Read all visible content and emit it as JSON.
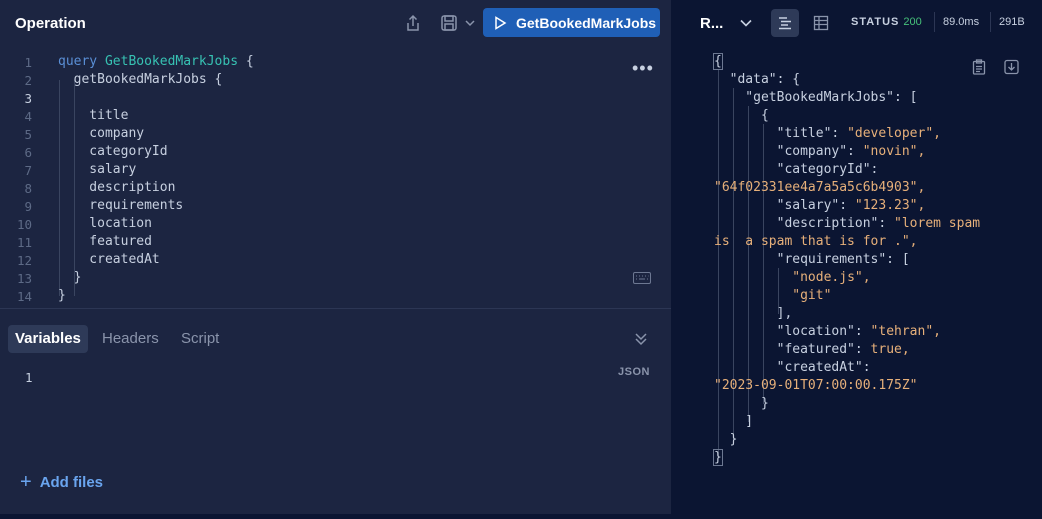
{
  "operation": {
    "title": "Operation",
    "run_label": "GetBookedMarkJobs",
    "code_lines": [
      {
        "num": "1",
        "text": ""
      },
      {
        "num": "2",
        "text": "  getBookedMarkJobs {"
      },
      {
        "num": "3",
        "text": ""
      },
      {
        "num": "4",
        "text": "    title"
      },
      {
        "num": "5",
        "text": "    company"
      },
      {
        "num": "6",
        "text": "    categoryId"
      },
      {
        "num": "7",
        "text": "    salary"
      },
      {
        "num": "8",
        "text": "    description"
      },
      {
        "num": "9",
        "text": "    requirements"
      },
      {
        "num": "10",
        "text": "    location"
      },
      {
        "num": "11",
        "text": "    featured"
      },
      {
        "num": "12",
        "text": "    createdAt"
      },
      {
        "num": "13",
        "text": "  }"
      },
      {
        "num": "14",
        "text": "}"
      }
    ],
    "line1_keyword": "query",
    "line1_name": "GetBookedMarkJobs",
    "line1_brace": " {"
  },
  "variables": {
    "tabs": [
      "Variables",
      "Headers",
      "Script"
    ],
    "line_num": "1",
    "format_label": "JSON",
    "add_files_label": "Add files"
  },
  "response": {
    "title": "R...",
    "status_label": "STATUS",
    "status_code": "200",
    "time": "89.0ms",
    "size": "291B",
    "lines": [
      "{",
      "  \"data\": {",
      "    \"getBookedMarkJobs\": [",
      "      {",
      "        \"title\": ",
      "        \"company\": ",
      "        \"categoryId\":",
      "",
      "        \"salary\": ",
      "        \"description\": ",
      "",
      "        \"requirements\": [",
      "          ",
      "          ",
      "        ],",
      "        \"location\": ",
      "        \"featured\": ",
      "        \"createdAt\":",
      "",
      "      }",
      "    ]",
      "  }",
      "}"
    ],
    "values": {
      "title": "\"developer\",",
      "company": "\"novin\",",
      "categoryId": "\"64f02331ee4a7a5a5c6b4903\",",
      "salary": "\"123.23\",",
      "description_1": "\"lorem spam",
      "description_2": "is  a spam that is for .\",",
      "req_1": "\"node.js\",",
      "req_2": "\"git\"",
      "location": "\"tehran\",",
      "featured": "true,",
      "createdAt": "\"2023-09-01T07:00:00.175Z\""
    }
  },
  "colors": {
    "panel_left": "#1c2541",
    "background": "#0b1532",
    "run_button": "#1f5fb6",
    "keyword": "#5a8fd6",
    "function_name": "#37c2b3",
    "string": "#e7b07a",
    "status_ok": "#46c17a"
  },
  "icons": {
    "share": "share-icon",
    "save": "save-icon",
    "play": "play-icon",
    "more": "more-icon",
    "keyboard": "keyboard-icon",
    "collapse": "chevrons-down-icon",
    "plus": "plus-icon",
    "text_view": "text-view-icon",
    "table_view": "table-view-icon",
    "copy": "clipboard-icon",
    "download": "download-icon"
  }
}
